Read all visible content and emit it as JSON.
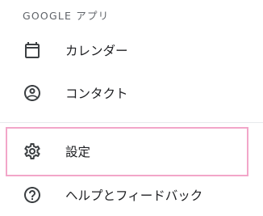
{
  "section": {
    "header": "GOOGLE アプリ"
  },
  "menu": {
    "items": [
      {
        "label": "カレンダー",
        "icon": "calendar-icon"
      },
      {
        "label": "コンタクト",
        "icon": "account-circle-icon"
      },
      {
        "label": "設定",
        "icon": "gear-icon",
        "highlighted": true
      },
      {
        "label": "ヘルプとフィードバック",
        "icon": "help-icon"
      }
    ]
  },
  "colors": {
    "icon": "#3c4043",
    "highlight_border": "#f2a6c9",
    "divider": "#e8eaed"
  }
}
